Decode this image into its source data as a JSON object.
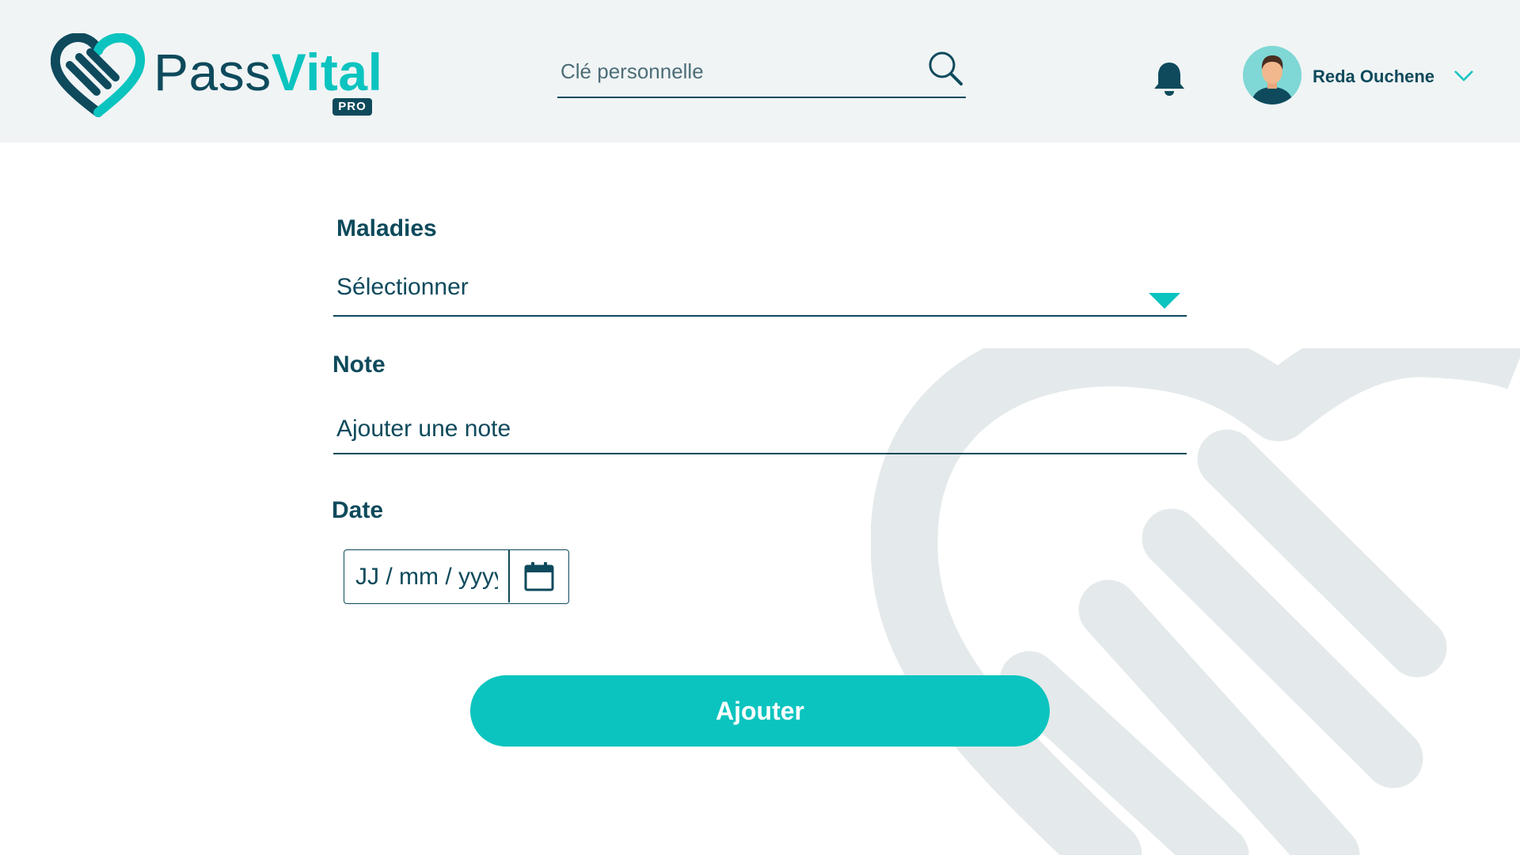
{
  "brand": {
    "name_part1": "Pass",
    "name_part2": "Vital",
    "badge": "PRO"
  },
  "header": {
    "search": {
      "placeholder": "Clé personnelle",
      "value": ""
    },
    "notifications": {
      "icon": "bell-icon"
    },
    "user": {
      "name": "Reda Ouchene",
      "avatar_icon": "avatar",
      "menu_icon": "chevron-down-icon"
    }
  },
  "form": {
    "maladies": {
      "label": "Maladies",
      "value": "Sélectionner"
    },
    "note": {
      "label": "Note",
      "placeholder": "Ajouter une note",
      "value": ""
    },
    "date": {
      "label": "Date",
      "placeholder": "JJ / mm / yyyy",
      "value": "",
      "icon": "calendar-icon"
    },
    "submit_label": "Ajouter"
  },
  "colors": {
    "primary": "#0e4a5c",
    "accent": "#0bc4bf",
    "header_bg": "#f0f4f5",
    "watermark": "#e4eaeb"
  }
}
